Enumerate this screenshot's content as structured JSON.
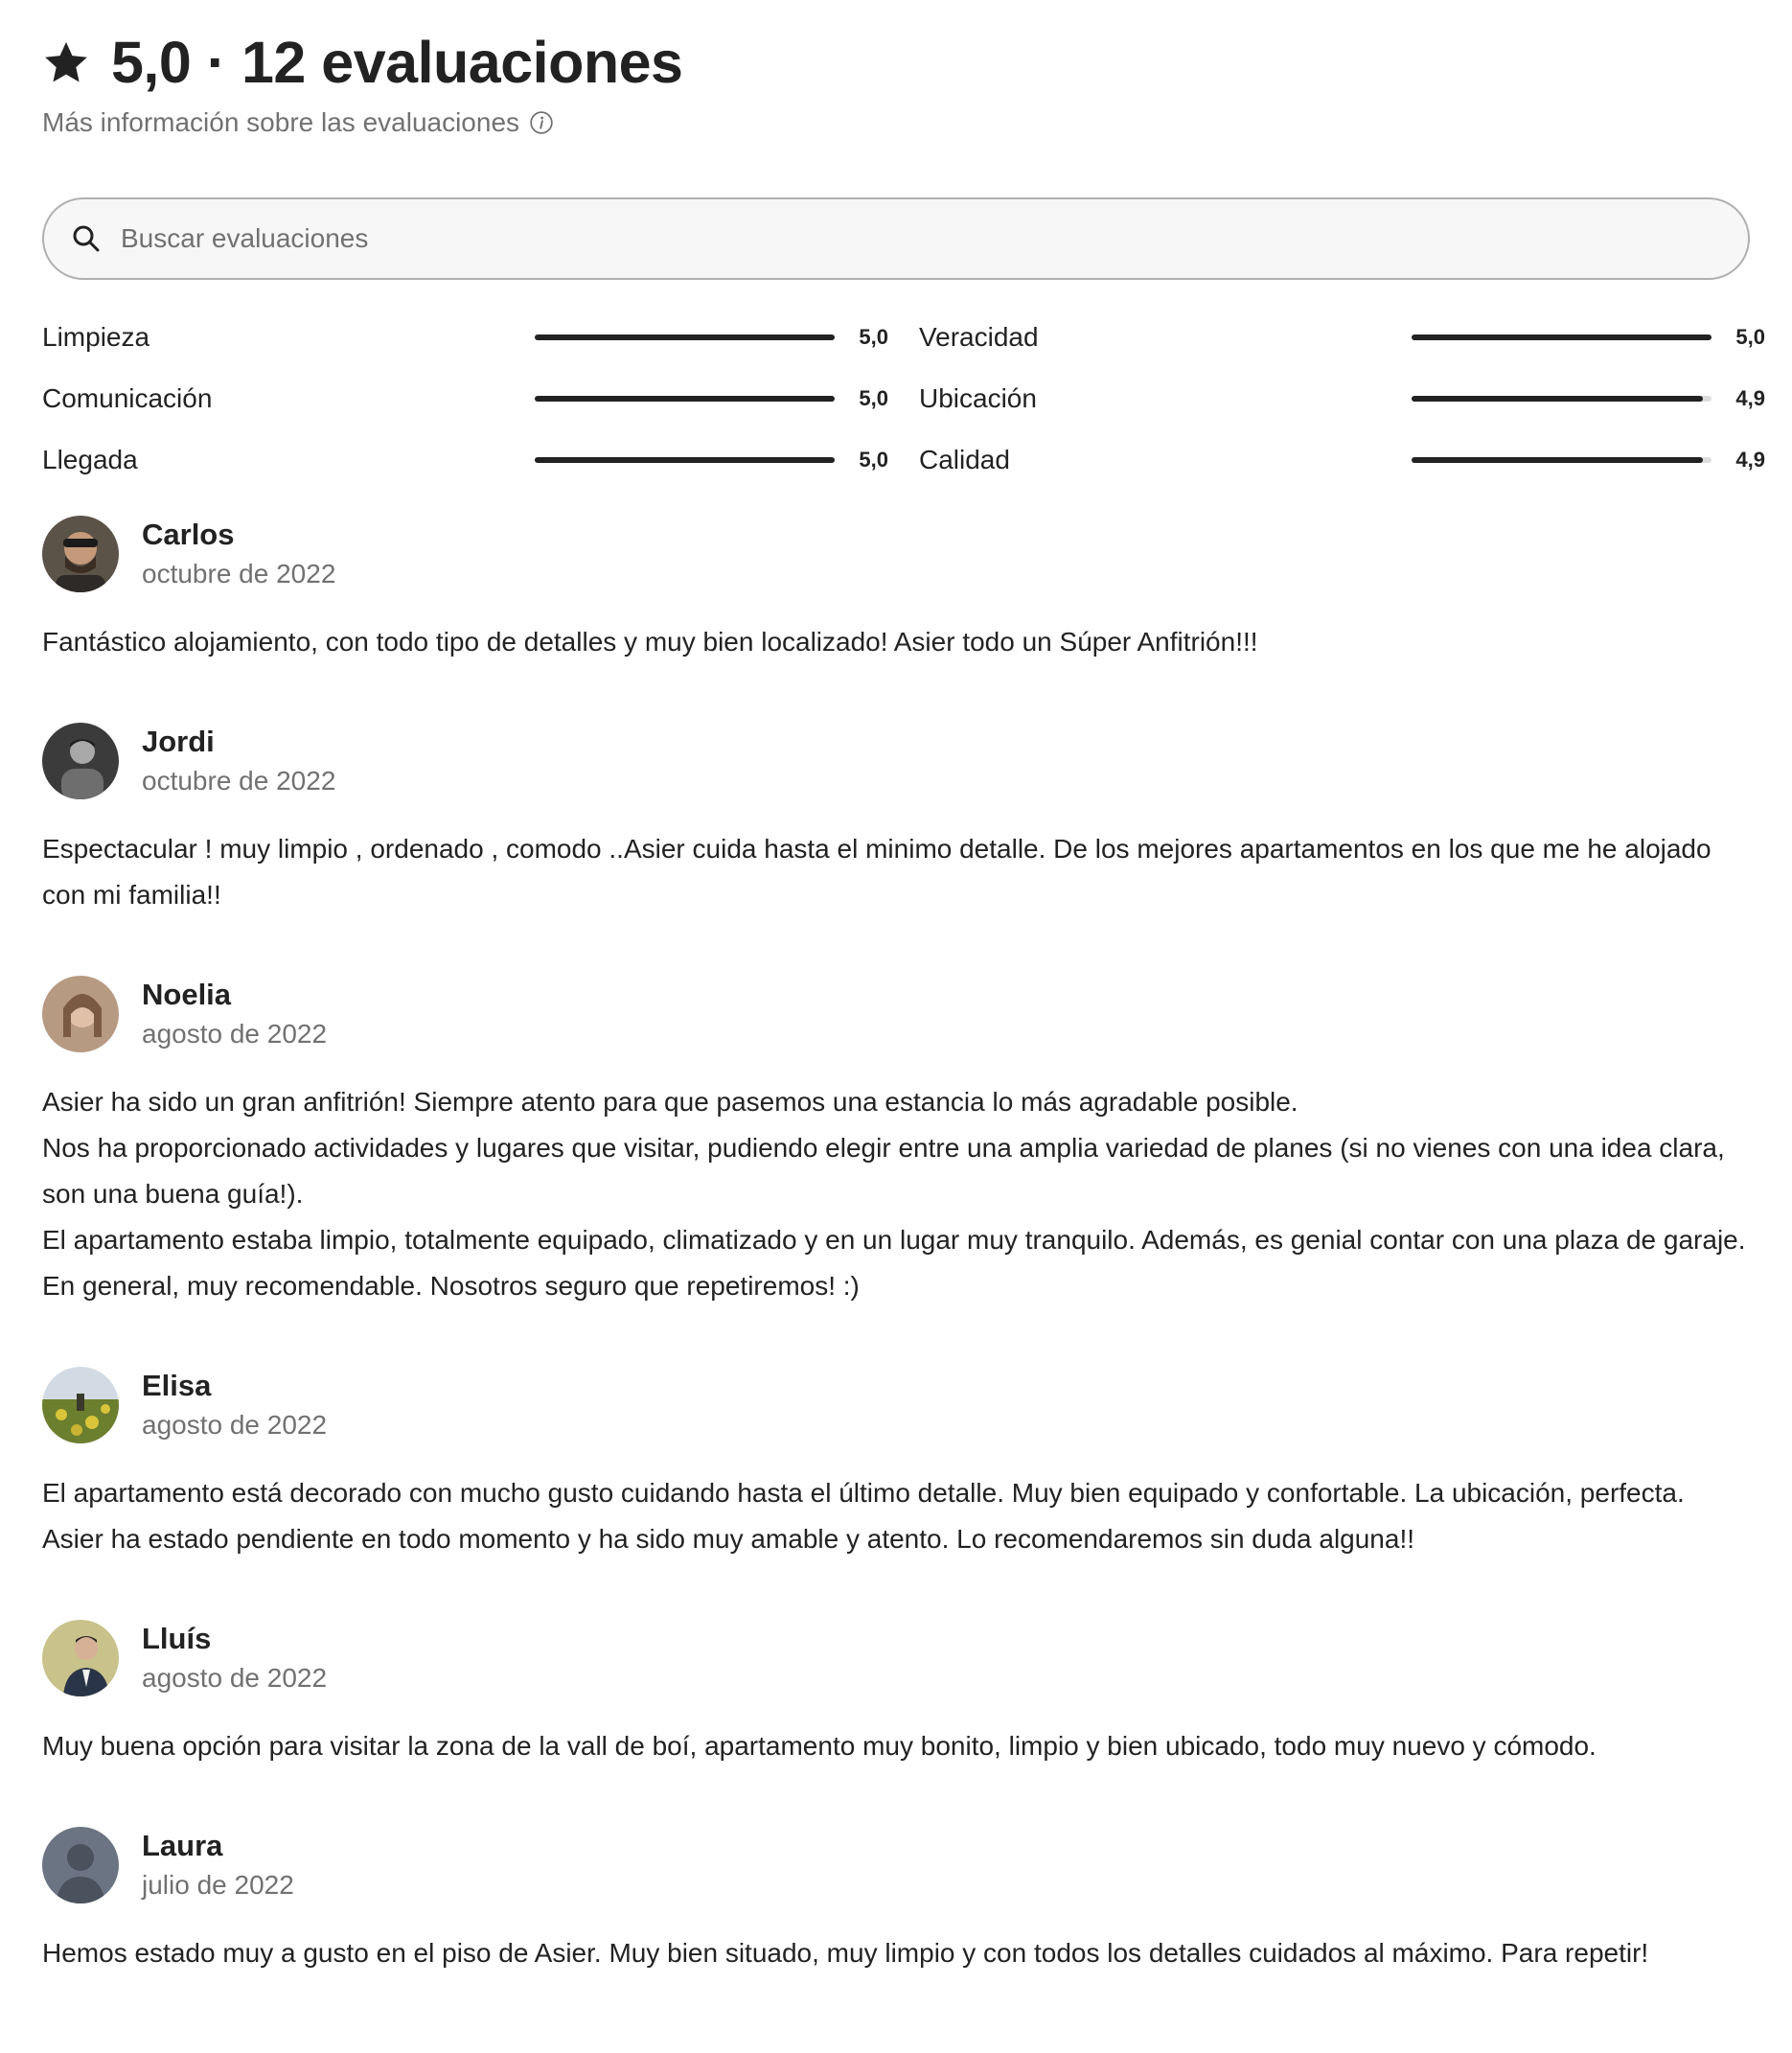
{
  "header": {
    "title": "5,0 · 12 evaluaciones",
    "subtitle": "Más información sobre las evaluaciones",
    "icons": {
      "star": "star-icon",
      "info": "info-icon"
    }
  },
  "search": {
    "placeholder": "Buscar evaluaciones",
    "value": "",
    "icon": "search-icon"
  },
  "ratings": [
    {
      "label": "Limpieza",
      "value": "5,0",
      "score": 5.0
    },
    {
      "label": "Veracidad",
      "value": "5,0",
      "score": 5.0
    },
    {
      "label": "Comunicación",
      "value": "5,0",
      "score": 5.0
    },
    {
      "label": "Ubicación",
      "value": "4,9",
      "score": 4.9
    },
    {
      "label": "Llegada",
      "value": "5,0",
      "score": 5.0
    },
    {
      "label": "Calidad",
      "value": "4,9",
      "score": 4.9
    }
  ],
  "reviews": [
    {
      "name": "Carlos",
      "date": "octubre de 2022",
      "text": "Fantástico alojamiento, con todo tipo de detalles y muy bien localizado! Asier todo un Súper Anfitrión!!!"
    },
    {
      "name": "Jordi",
      "date": "octubre de 2022",
      "text": "Espectacular ! muy limpio , ordenado , comodo ..Asier cuida hasta el minimo detalle. De los mejores apartamentos en los que me he alojado con mi familia!!"
    },
    {
      "name": "Noelia",
      "date": "agosto de 2022",
      "text": "Asier ha sido un gran anfitrión! Siempre atento para que pasemos una estancia lo más agradable posible.\nNos ha proporcionado actividades y lugares que visitar, pudiendo elegir entre una amplia variedad de planes (si no vienes con una idea clara, son una buena guía!).\nEl apartamento estaba limpio, totalmente equipado, climatizado y en un lugar muy tranquilo. Además, es genial contar con una plaza de garaje.\nEn general, muy recomendable. Nosotros seguro que repetiremos! :)"
    },
    {
      "name": "Elisa",
      "date": "agosto de 2022",
      "text": "El apartamento está decorado con mucho gusto cuidando hasta el último detalle. Muy bien equipado y confortable. La ubicación, perfecta. Asier ha estado pendiente en todo momento y ha sido muy amable y atento. Lo recomendaremos sin duda alguna!!"
    },
    {
      "name": "Lluís",
      "date": "agosto de 2022",
      "text": "Muy buena opción para visitar la zona de la vall de boí, apartamento muy bonito, limpio y bien ubicado, todo muy nuevo y cómodo."
    },
    {
      "name": "Laura",
      "date": "julio de 2022",
      "text": "Hemos estado muy a gusto en el piso de Asier. Muy bien situado, muy limpio y con todos los detalles cuidados al máximo. Para repetir!"
    }
  ],
  "colors": {
    "text": "#222222",
    "muted": "#717171",
    "bar_track": "#dddddd",
    "bar_fill": "#222222",
    "search_border": "#b0b0b0"
  }
}
